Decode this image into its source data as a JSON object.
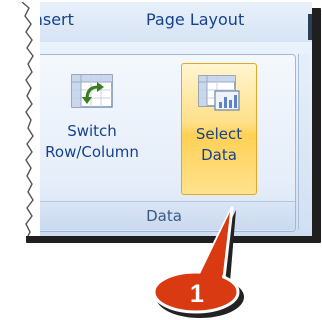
{
  "tabs": [
    {
      "label": "Insert"
    },
    {
      "label": "Page Layout"
    }
  ],
  "group": {
    "title": "Data",
    "buttons": [
      {
        "label_line1": "Switch",
        "label_line2": "Row/Column",
        "icon": "switch-row-column-icon"
      },
      {
        "label_line1": "Select",
        "label_line2": "Data",
        "icon": "select-data-icon"
      }
    ]
  },
  "callout": {
    "number": "1",
    "color": "#d93a12"
  },
  "colors": {
    "tab_text": "#15428b",
    "highlight": "#ffd055",
    "highlight_border": "#e3a826"
  }
}
